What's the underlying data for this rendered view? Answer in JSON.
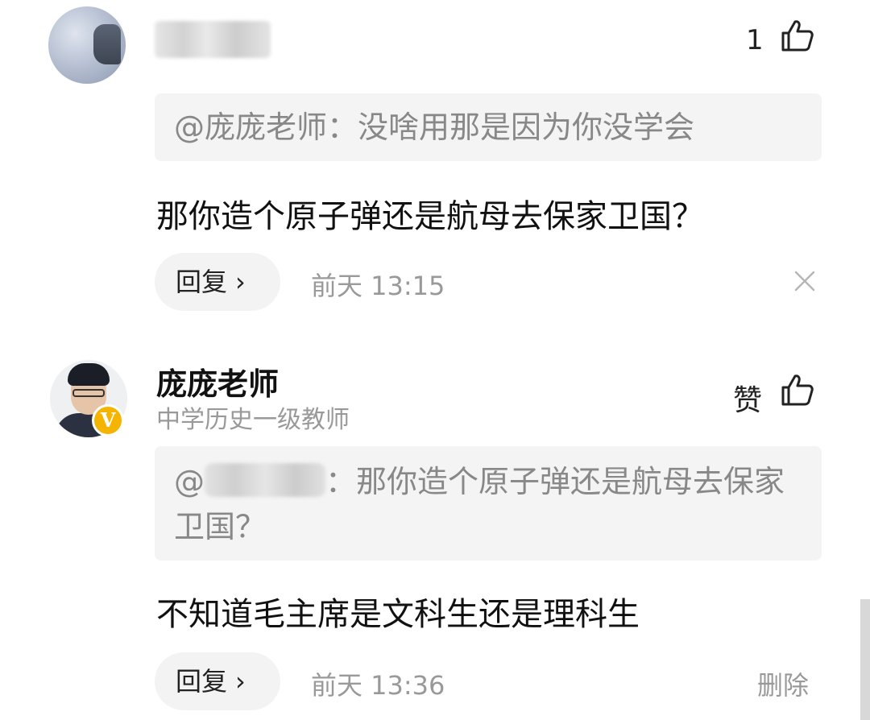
{
  "comment1": {
    "likes": "1",
    "quote": "@庞庞老师：没啥用那是因为你没学会",
    "content": "那你造个原子弹还是航母去保家卫国？",
    "reply_label": "回复",
    "reply_chevron": "›",
    "time": "前天  13:15",
    "close_icon": "close-icon"
  },
  "comment2": {
    "author": "庞庞老师",
    "author_title": "中学历史一级教师",
    "verified_badge": "V",
    "like_label": "赞",
    "quote_prefix": "@",
    "quote_text": "：那你造个原子弹还是航母去保家卫国？",
    "content": "不知道毛主席是文科生还是理科生",
    "reply_label": "回复",
    "reply_chevron": "›",
    "time": "前天  13:36",
    "delete_label": "删除"
  },
  "colors": {
    "badge": "#f5b400",
    "muted_text": "#999999",
    "quote_bg": "#f4f4f4"
  }
}
